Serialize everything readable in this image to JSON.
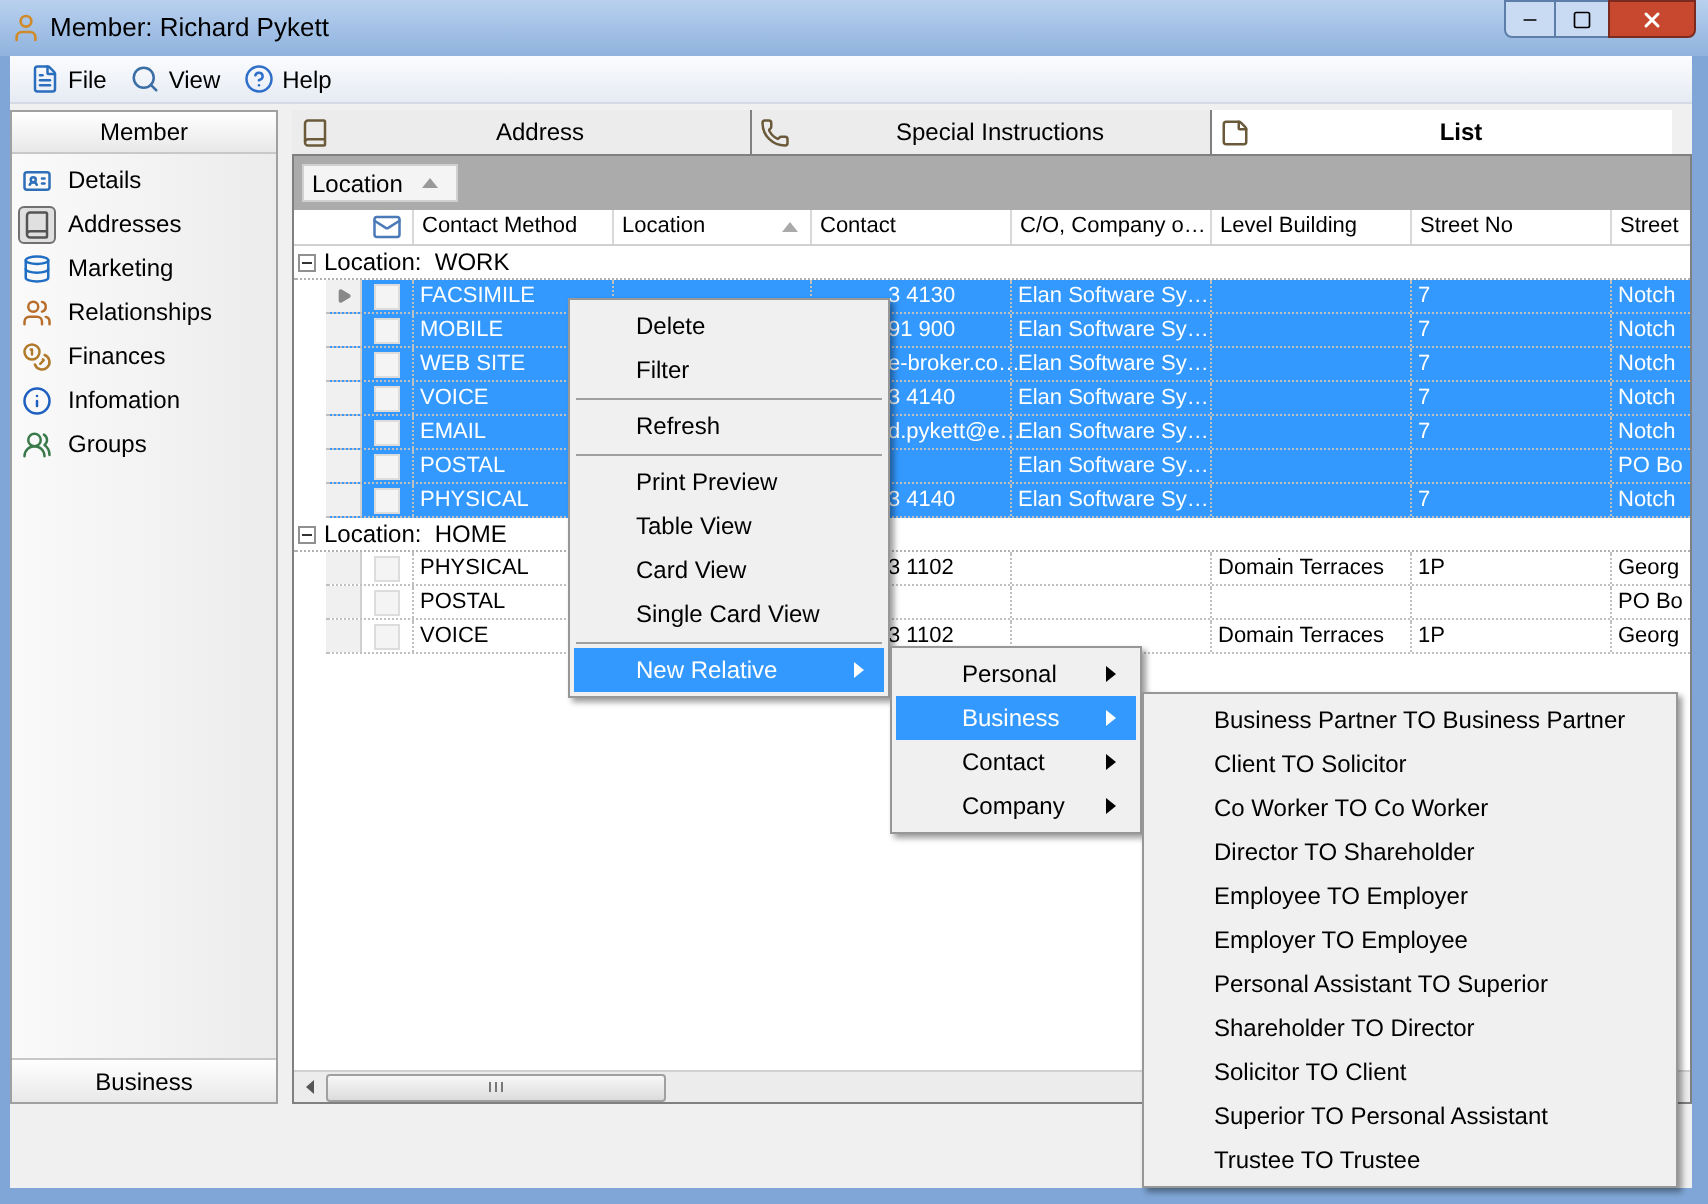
{
  "window": {
    "title": "Member: Richard Pykett"
  },
  "menu_bar": [
    {
      "label": "File"
    },
    {
      "label": "View"
    },
    {
      "label": "Help"
    }
  ],
  "sidebar": {
    "header": "Member",
    "items": [
      {
        "label": "Details",
        "selected": false
      },
      {
        "label": "Addresses",
        "selected": true
      },
      {
        "label": "Marketing",
        "selected": false
      },
      {
        "label": "Relationships",
        "selected": false
      },
      {
        "label": "Finances",
        "selected": false
      },
      {
        "label": "Infomation",
        "selected": false
      },
      {
        "label": "Groups",
        "selected": false
      }
    ],
    "footer": "Business"
  },
  "tabs": [
    {
      "label": "Address",
      "selected": false
    },
    {
      "label": "Special Instructions",
      "selected": false
    },
    {
      "label": "List",
      "selected": true
    }
  ],
  "group_by": {
    "label": "Location"
  },
  "table": {
    "columns": [
      {
        "label": "Contact Method",
        "sorted": false
      },
      {
        "label": "Location",
        "sorted": true
      },
      {
        "label": "Contact",
        "sorted": false
      },
      {
        "label": "C/O, Company o…",
        "sorted": false
      },
      {
        "label": "Level Building",
        "sorted": false
      },
      {
        "label": "Street No",
        "sorted": false
      },
      {
        "label": "Street",
        "sorted": false
      }
    ],
    "groups": [
      {
        "label": "Location:",
        "value": "WORK",
        "expanded": true,
        "rows": [
          {
            "selected": true,
            "current": true,
            "cells": [
              "FACSIMILE",
              null,
              "3 4130",
              "Elan Software Sy…",
              null,
              "7",
              "Notch"
            ]
          },
          {
            "selected": true,
            "current": false,
            "cells": [
              "MOBILE",
              null,
              "91 900",
              "Elan Software Sy…",
              null,
              "7",
              "Notch"
            ]
          },
          {
            "selected": true,
            "current": false,
            "cells": [
              "WEB SITE",
              null,
              "e-broker.co…",
              "Elan Software Sy…",
              null,
              "7",
              "Notch"
            ]
          },
          {
            "selected": true,
            "current": false,
            "cells": [
              "VOICE",
              null,
              "3 4140",
              "Elan Software Sy…",
              null,
              "7",
              "Notch"
            ]
          },
          {
            "selected": true,
            "current": false,
            "cells": [
              "EMAIL",
              null,
              "d.pykett@e…",
              "Elan Software Sy…",
              null,
              "7",
              "Notch"
            ]
          },
          {
            "selected": true,
            "current": false,
            "cells": [
              "POSTAL",
              null,
              null,
              "Elan Software Sy…",
              null,
              null,
              "PO Bo"
            ]
          },
          {
            "selected": true,
            "current": false,
            "cells": [
              "PHYSICAL",
              null,
              "3 4140",
              "Elan Software Sy…",
              null,
              "7",
              "Notch"
            ]
          }
        ]
      },
      {
        "label": "Location:",
        "value": "HOME",
        "expanded": true,
        "rows": [
          {
            "selected": false,
            "current": false,
            "cells": [
              "PHYSICAL",
              null,
              "3 1102",
              null,
              "Domain Terraces",
              "1P",
              "Georg"
            ]
          },
          {
            "selected": false,
            "current": false,
            "cells": [
              "POSTAL",
              null,
              null,
              null,
              null,
              null,
              "PO Bo"
            ]
          },
          {
            "selected": false,
            "current": false,
            "cells": [
              "VOICE",
              null,
              "3 1102",
              null,
              "Domain Terraces",
              "1P",
              "Georg"
            ]
          }
        ]
      }
    ]
  },
  "context_menu": {
    "items": [
      {
        "kind": "item",
        "label": "Delete",
        "selected": false
      },
      {
        "kind": "item",
        "label": "Filter",
        "selected": false
      },
      {
        "kind": "separator"
      },
      {
        "kind": "item",
        "label": "Refresh",
        "selected": false
      },
      {
        "kind": "separator"
      },
      {
        "kind": "item",
        "label": "Print Preview",
        "selected": false
      },
      {
        "kind": "item",
        "label": "Table View",
        "selected": false
      },
      {
        "kind": "item",
        "label": "Card View",
        "selected": false
      },
      {
        "kind": "item",
        "label": "Single Card View",
        "selected": false
      },
      {
        "kind": "separator"
      },
      {
        "kind": "submenu",
        "label": "New Relative",
        "selected": true
      }
    ]
  },
  "relative_menu": {
    "items": [
      {
        "label": "Personal",
        "selected": false
      },
      {
        "label": "Business",
        "selected": true
      },
      {
        "label": "Contact",
        "selected": false
      },
      {
        "label": "Company",
        "selected": false
      }
    ]
  },
  "business_menu": {
    "items": [
      "Business Partner TO Business Partner",
      "Client TO Solicitor",
      "Co Worker TO Co Worker",
      "Director TO Shareholder",
      "Employee TO Employer",
      "Employer TO Employee",
      "Personal Assistant TO Superior",
      "Shareholder TO Director",
      "Solicitor TO Client",
      "Superior TO Personal Assistant",
      "Trustee TO Trustee"
    ]
  }
}
